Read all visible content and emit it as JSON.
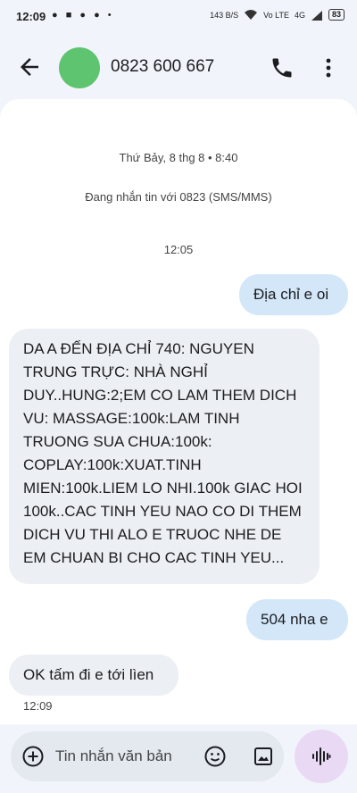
{
  "status_bar": {
    "time": "12:09",
    "left_icons": "● ■ ● ● •",
    "net_speed": "143 B/S",
    "vo_lte": "Vo LTE",
    "network": "4G",
    "battery": "83"
  },
  "header": {
    "contact_name": "0823 600 667",
    "avatar_color": "#5fc46f"
  },
  "thread": {
    "date_header": "Thứ Bảy, 8 thg 8 • 8:40",
    "conversation_note": "Đang nhắn tin với 0823 (SMS/MMS)",
    "time_divider": "12:05",
    "messages": [
      {
        "direction": "sent",
        "text": "Địa chỉ e oi"
      },
      {
        "direction": "received",
        "text": "DA A ĐẾN ĐỊA CHỈ 740: NGUYEN TRUNG TRỰC: NHÀ NGHỈ DUY..HUNG:2;EM CO LAM THEM DICH VU: MASSAGE:100k:LAM TINH TRUONG SUA CHUA:100k: COPLAY:100k:XUAT.TINH MIEN:100k.LIEM LO NHI.100k GIAC HOI 100k..CAC TINH YEU NAO CO  DI THEM DICH VU THI ALO E TRUOC NHE DE EM CHUAN BI CHO CAC TINH YEU..."
      },
      {
        "direction": "sent",
        "text": "504 nha e"
      },
      {
        "direction": "received",
        "text": "OK tấm đi e tới lìen",
        "time": "12:09"
      }
    ]
  },
  "composer": {
    "placeholder": "Tin nhắn văn bản"
  },
  "colors": {
    "sent_bubble": "#d3e7f9",
    "received_bubble": "#eceff3",
    "mic_button": "#ead9f4"
  }
}
